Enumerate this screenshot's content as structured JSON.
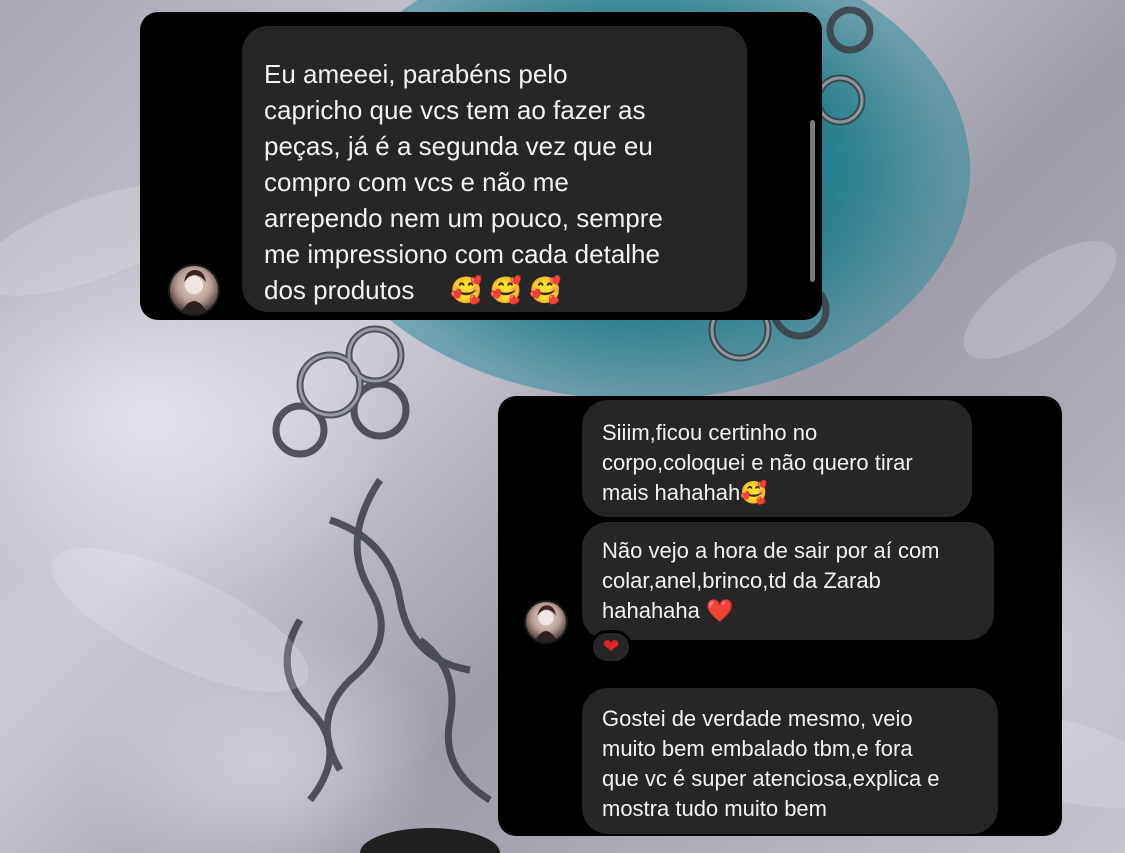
{
  "top_thread": {
    "messages": [
      {
        "text": "Eu ameeei, parabéns pelo\ncapricho que vcs tem ao fazer as\npeças, já é a segunda vez que eu\ncompro com vcs e não me\narrependo nem um pouco, sempre\nme impressiono com cada detalhe\ndos produtos",
        "emoji": "🥰 🥰 🥰"
      }
    ]
  },
  "bottom_thread": {
    "messages": [
      {
        "text": "Siiim,ficou certinho no\ncorpo,coloquei e não quero tirar\nmais hahahah",
        "emoji": "🥰"
      },
      {
        "text": "Não vejo a hora de sair por aí com\ncolar,anel,brinco,td da Zarab\nhahahaha",
        "emoji": "❤️"
      },
      {
        "text": "Gostei de verdade mesmo, veio\nmuito bem embalado tbm,e fora\nque vc é super atenciosa,explica e\nmostra tudo muito bem",
        "emoji": ""
      }
    ],
    "reaction": "❤"
  },
  "icons": {
    "avatar": "user-avatar-icon",
    "reaction": "heart-icon"
  },
  "colors": {
    "card_bg": "#000000",
    "bubble_bg": "#262626",
    "bubble_text": "#f2f2f2",
    "heart": "#e0242a",
    "velvet_bg": "#b9b7c2",
    "teal_accent": "#2f8f9c"
  }
}
